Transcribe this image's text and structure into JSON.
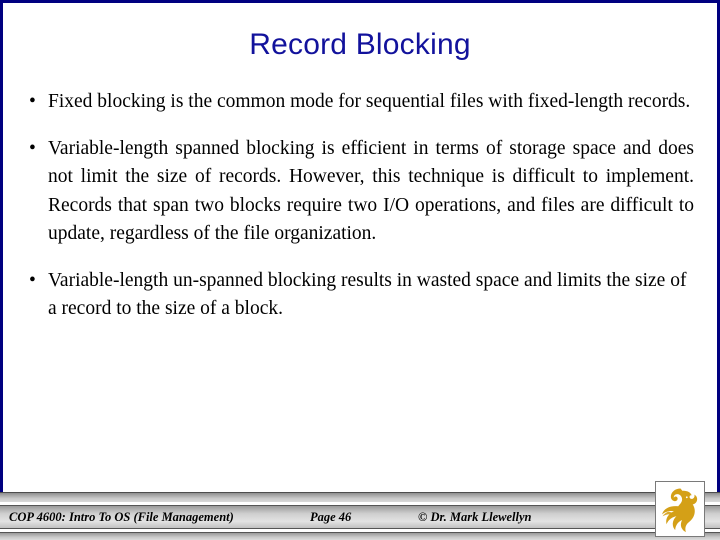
{
  "slide": {
    "title": "Record Blocking",
    "title_color": "#12129c",
    "frame_color": "#000080",
    "background": "#ffffff",
    "bullets": [
      {
        "marker": "•",
        "text": "Fixed blocking is the common mode for sequential files with fixed-length records."
      },
      {
        "marker": "•",
        "text": "Variable-length spanned blocking is efficient in terms of storage space and does not limit the size of records.  However, this technique is difficult to implement.  Records that span two blocks require two I/O operations, and files are difficult to update, regardless of the file organization."
      },
      {
        "marker": "•",
        "text": "Variable-length un-spanned blocking results in wasted space and limits the size of a record to the size of a block."
      }
    ]
  },
  "footer": {
    "course": "COP 4600: Intro To OS  (File Management)",
    "page": "Page 46",
    "author": "© Dr. Mark Llewellyn",
    "logo_name": "ucf-pegasus-logo",
    "logo_color": "#d4a017"
  }
}
